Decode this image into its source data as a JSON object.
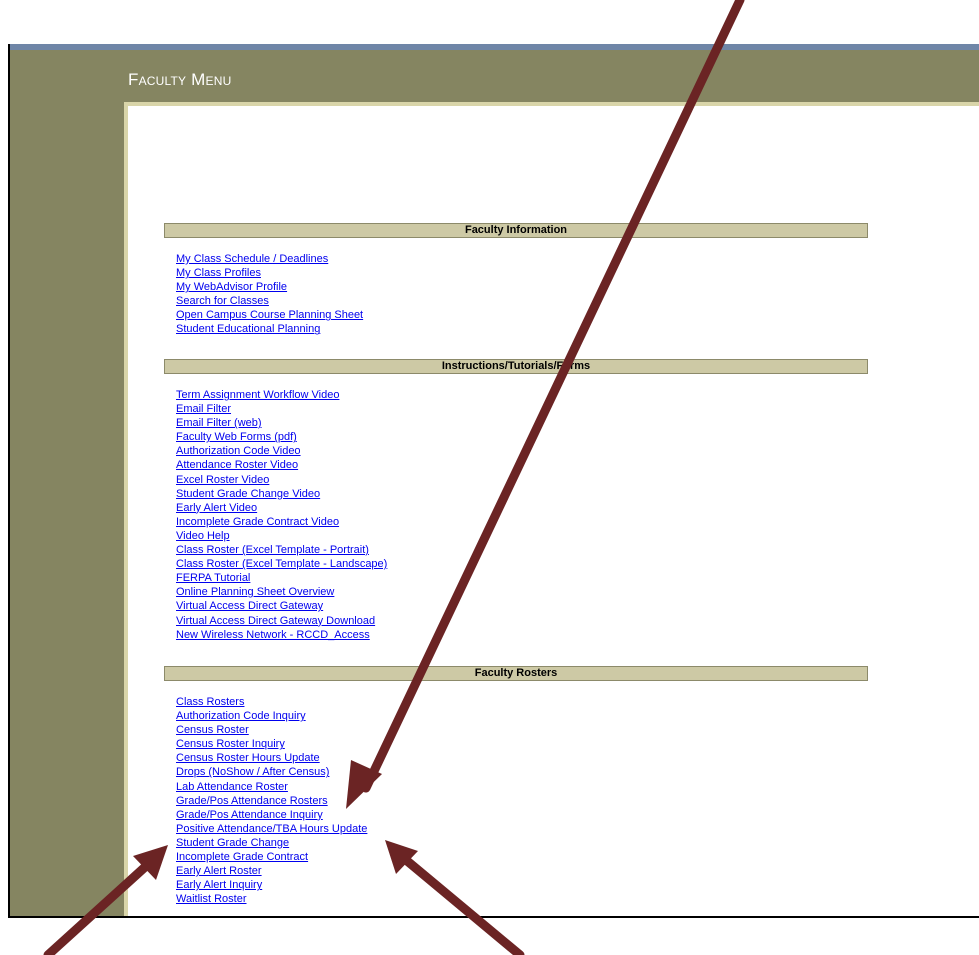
{
  "header": {
    "title": "Faculty Menu"
  },
  "sections": {
    "faculty_information": {
      "title": "Faculty Information",
      "links": [
        "My Class Schedule / Deadlines",
        "My Class Profiles",
        "My WebAdvisor Profile",
        "Search for Classes",
        "Open Campus Course Planning Sheet",
        "Student Educational Planning"
      ]
    },
    "instructions": {
      "title": "Instructions/Tutorials/Forms",
      "links": [
        "Term Assignment Workflow Video",
        "Email Filter",
        "Email Filter (web)",
        "Faculty Web Forms (pdf)",
        "Authorization Code Video",
        "Attendance Roster Video",
        "Excel Roster Video",
        "Student Grade Change Video",
        "Early Alert Video",
        "Incomplete Grade Contract Video",
        "Video Help",
        "Class Roster (Excel Template - Portrait)",
        "Class Roster (Excel Template - Landscape)",
        "FERPA Tutorial",
        "Online Planning Sheet Overview",
        "Virtual Access Direct Gateway",
        "Virtual Access Direct Gateway Download",
        "New Wireless Network - RCCD_Access"
      ]
    },
    "rosters": {
      "title": "Faculty Rosters",
      "links": [
        "Class Rosters",
        "Authorization Code Inquiry",
        "Census Roster",
        "Census Roster Inquiry",
        "Census Roster Hours Update",
        "Drops (NoShow / After Census)",
        "Lab Attendance Roster",
        "Grade/Pos Attendance Rosters",
        "Grade/Pos Attendance Inquiry",
        "Positive Attendance/TBA Hours Update",
        "Student Grade Change",
        "Incomplete Grade Contract",
        "Early Alert Roster",
        "Early Alert Inquiry",
        "Waitlist Roster"
      ]
    }
  },
  "colors": {
    "header_bg": "#858561",
    "section_header_bg": "#cdc9a5",
    "link": "#0000ee",
    "arrow": "#6b2424"
  }
}
